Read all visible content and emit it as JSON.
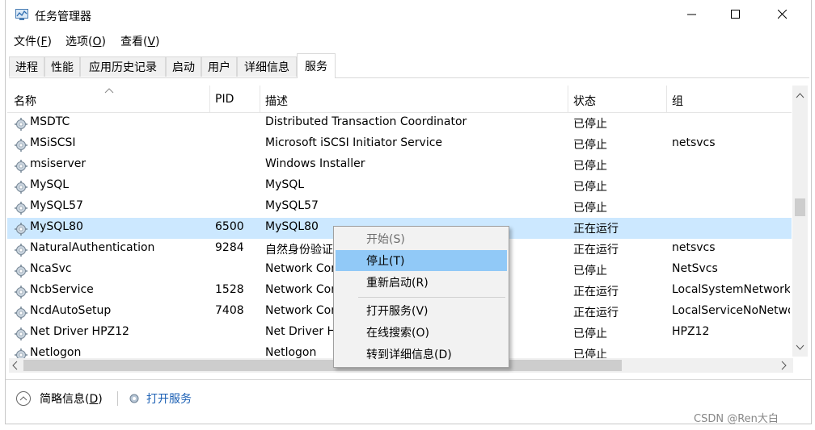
{
  "window": {
    "title": "任务管理器",
    "minimize": "—",
    "maximize": "☐",
    "close": "✕"
  },
  "menu": [
    {
      "label": "文件(",
      "key": "F",
      "suffix": ")"
    },
    {
      "label": "选项(",
      "key": "O",
      "suffix": ")"
    },
    {
      "label": "查看(",
      "key": "V",
      "suffix": ")"
    }
  ],
  "tabs": [
    "进程",
    "性能",
    "应用历史记录",
    "启动",
    "用户",
    "详细信息",
    "服务"
  ],
  "active_tab": "服务",
  "columns": [
    "名称",
    "PID",
    "描述",
    "状态",
    "组"
  ],
  "rows": [
    {
      "name": "MSDTC",
      "pid": "",
      "desc": "Distributed Transaction Coordinator",
      "status": "已停止",
      "group": ""
    },
    {
      "name": "MSiSCSI",
      "pid": "",
      "desc": "Microsoft iSCSI Initiator Service",
      "status": "已停止",
      "group": "netsvcs"
    },
    {
      "name": "msiserver",
      "pid": "",
      "desc": "Windows Installer",
      "status": "已停止",
      "group": ""
    },
    {
      "name": "MySQL",
      "pid": "",
      "desc": "MySQL",
      "status": "已停止",
      "group": ""
    },
    {
      "name": "MySQL57",
      "pid": "",
      "desc": "MySQL57",
      "status": "已停止",
      "group": ""
    },
    {
      "name": "MySQL80",
      "pid": "6500",
      "desc": "MySQL80",
      "status": "正在运行",
      "group": ""
    },
    {
      "name": "NaturalAuthentication",
      "pid": "9284",
      "desc": "自然身份验证",
      "status": "正在运行",
      "group": "netsvcs"
    },
    {
      "name": "NcaSvc",
      "pid": "",
      "desc": "Network Connectivity Assistant",
      "status": "已停止",
      "group": "NetSvcs"
    },
    {
      "name": "NcbService",
      "pid": "1528",
      "desc": "Network Connection Broker",
      "status": "正在运行",
      "group": "LocalSystemNetworkRestricted"
    },
    {
      "name": "NcdAutoSetup",
      "pid": "7408",
      "desc": "Network Connected Devices Auto-Setup",
      "status": "正在运行",
      "group": "LocalServiceNoNetwork"
    },
    {
      "name": "Net Driver HPZ12",
      "pid": "",
      "desc": "Net Driver HPZ12",
      "status": "已停止",
      "group": "HPZ12"
    },
    {
      "name": "Netlogon",
      "pid": "",
      "desc": "Netlogon",
      "status": "已停止",
      "group": ""
    }
  ],
  "selected_row": "MySQL80",
  "context_menu": {
    "items": [
      {
        "label": "开始(S)",
        "state": "disabled"
      },
      {
        "label": "停止(T)",
        "state": "hover"
      },
      {
        "label": "重新启动(R)",
        "state": "normal"
      },
      {
        "label": "打开服务(V)",
        "state": "normal"
      },
      {
        "label": "在线搜索(O)",
        "state": "normal"
      },
      {
        "label": "转到详细信息(D)",
        "state": "normal"
      }
    ]
  },
  "footer": {
    "brief_label": "简略信息(",
    "brief_key": "D",
    "brief_suffix": ")",
    "open_services": "打开服务"
  },
  "watermark": "CSDN @Ren大白",
  "colors": {
    "selected_row": "#cce8ff",
    "menu_hover": "#91c9f7",
    "link": "#1a5fb4"
  }
}
